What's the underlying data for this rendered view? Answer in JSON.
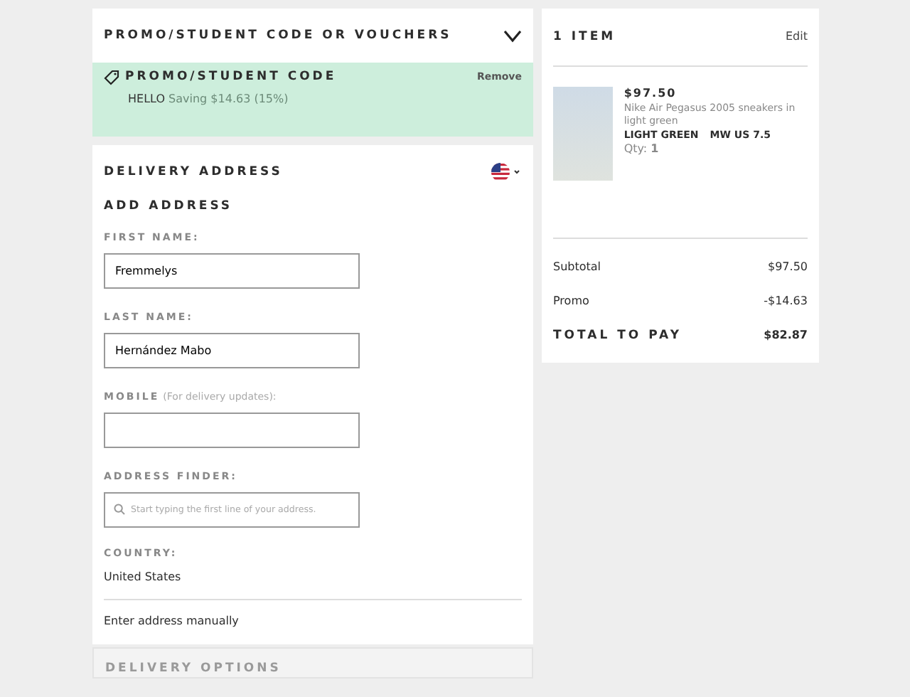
{
  "promo_section": {
    "title": "PROMO/STUDENT CODE OR VOUCHERS",
    "expanded": false
  },
  "applied_promo": {
    "title": "PROMO/STUDENT CODE",
    "code": "HELLO",
    "saving": "Saving $14.63 (15%)",
    "remove": "Remove"
  },
  "delivery_address": {
    "title": "DELIVERY ADDRESS",
    "subtitle": "ADD ADDRESS",
    "fields": [
      {
        "label": "FIRST NAME:",
        "value": "Fremmelys"
      },
      {
        "label": "LAST NAME:",
        "value": "Hernández Mabo"
      },
      {
        "label": "MOBILE",
        "hint": "(For delivery updates):"
      },
      {
        "label": "ADDRESS FINDER:",
        "placeholder": "Start typing the first line of your address.",
        "kind": "search"
      }
    ],
    "country_label": "COUNTRY:",
    "country": "United States",
    "manual_link": "Enter address manually"
  },
  "delivery_options": {
    "title": "DELIVERY OPTIONS",
    "disabled": true
  },
  "bag": {
    "title": "1 ITEM",
    "edit": "Edit",
    "items": [
      {
        "price": "$97.50",
        "name": "Nike Air Pegasus 2005 sneakers in light green",
        "color_label": "LIGHT GREEN",
        "size": "MW US 7.5",
        "qty": "Qty: **1**"
      }
    ],
    "totals": [
      {
        "kind": "line",
        "label": "Subtotal",
        "value": "$97.50"
      },
      {
        "kind": "line",
        "label": "Promo",
        "value": "-$14.63"
      },
      {
        "kind": "total",
        "label": "TOTAL TO PAY",
        "value": "$82.87"
      }
    ]
  }
}
